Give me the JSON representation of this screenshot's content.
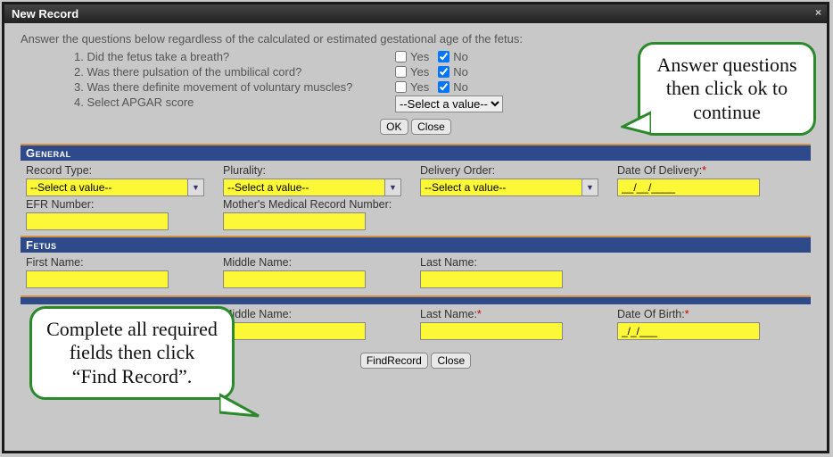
{
  "window": {
    "title": "New Record",
    "close": "×"
  },
  "intro": "Answer the questions below regardless of the calculated or estimated gestational age of the fetus:",
  "questions": {
    "q1": "1. Did the fetus take a breath?",
    "q2": "2. Was there pulsation of the umbilical cord?",
    "q3": "3. Was there definite movement of voluntary muscles?",
    "q4": "4. Select APGAR score",
    "yes": "Yes",
    "no": "No",
    "apgar_placeholder": "--Select a value--"
  },
  "buttons": {
    "ok": "OK",
    "close": "Close",
    "findrecord": "FindRecord"
  },
  "sections": {
    "general": "General",
    "fetus": "Fetus"
  },
  "general": {
    "record_type_label": "Record Type:",
    "record_type_value": "--Select a value--",
    "plurality_label": "Plurality:",
    "plurality_value": "--Select a value--",
    "delivery_order_label": "Delivery Order:",
    "delivery_order_value": "--Select a value--",
    "date_of_delivery_label": "Date Of Delivery:",
    "date_of_delivery_value": "__/__/____",
    "efr_label": "EFR Number:",
    "mmrn_label": "Mother's Medical Record Number:"
  },
  "fetus": {
    "first_label": "First Name:",
    "middle_label": "Middle Name:",
    "last_label": "Last Name:"
  },
  "mother": {
    "middle_label": "Middle Name:",
    "last_label": "Last Name:",
    "dob_label": "Date Of Birth:",
    "dob_value": "_/_/___"
  },
  "callouts": {
    "c1": "Answer questions then click ok to continue",
    "c2": "Complete all required fields then click “Find Record”."
  }
}
